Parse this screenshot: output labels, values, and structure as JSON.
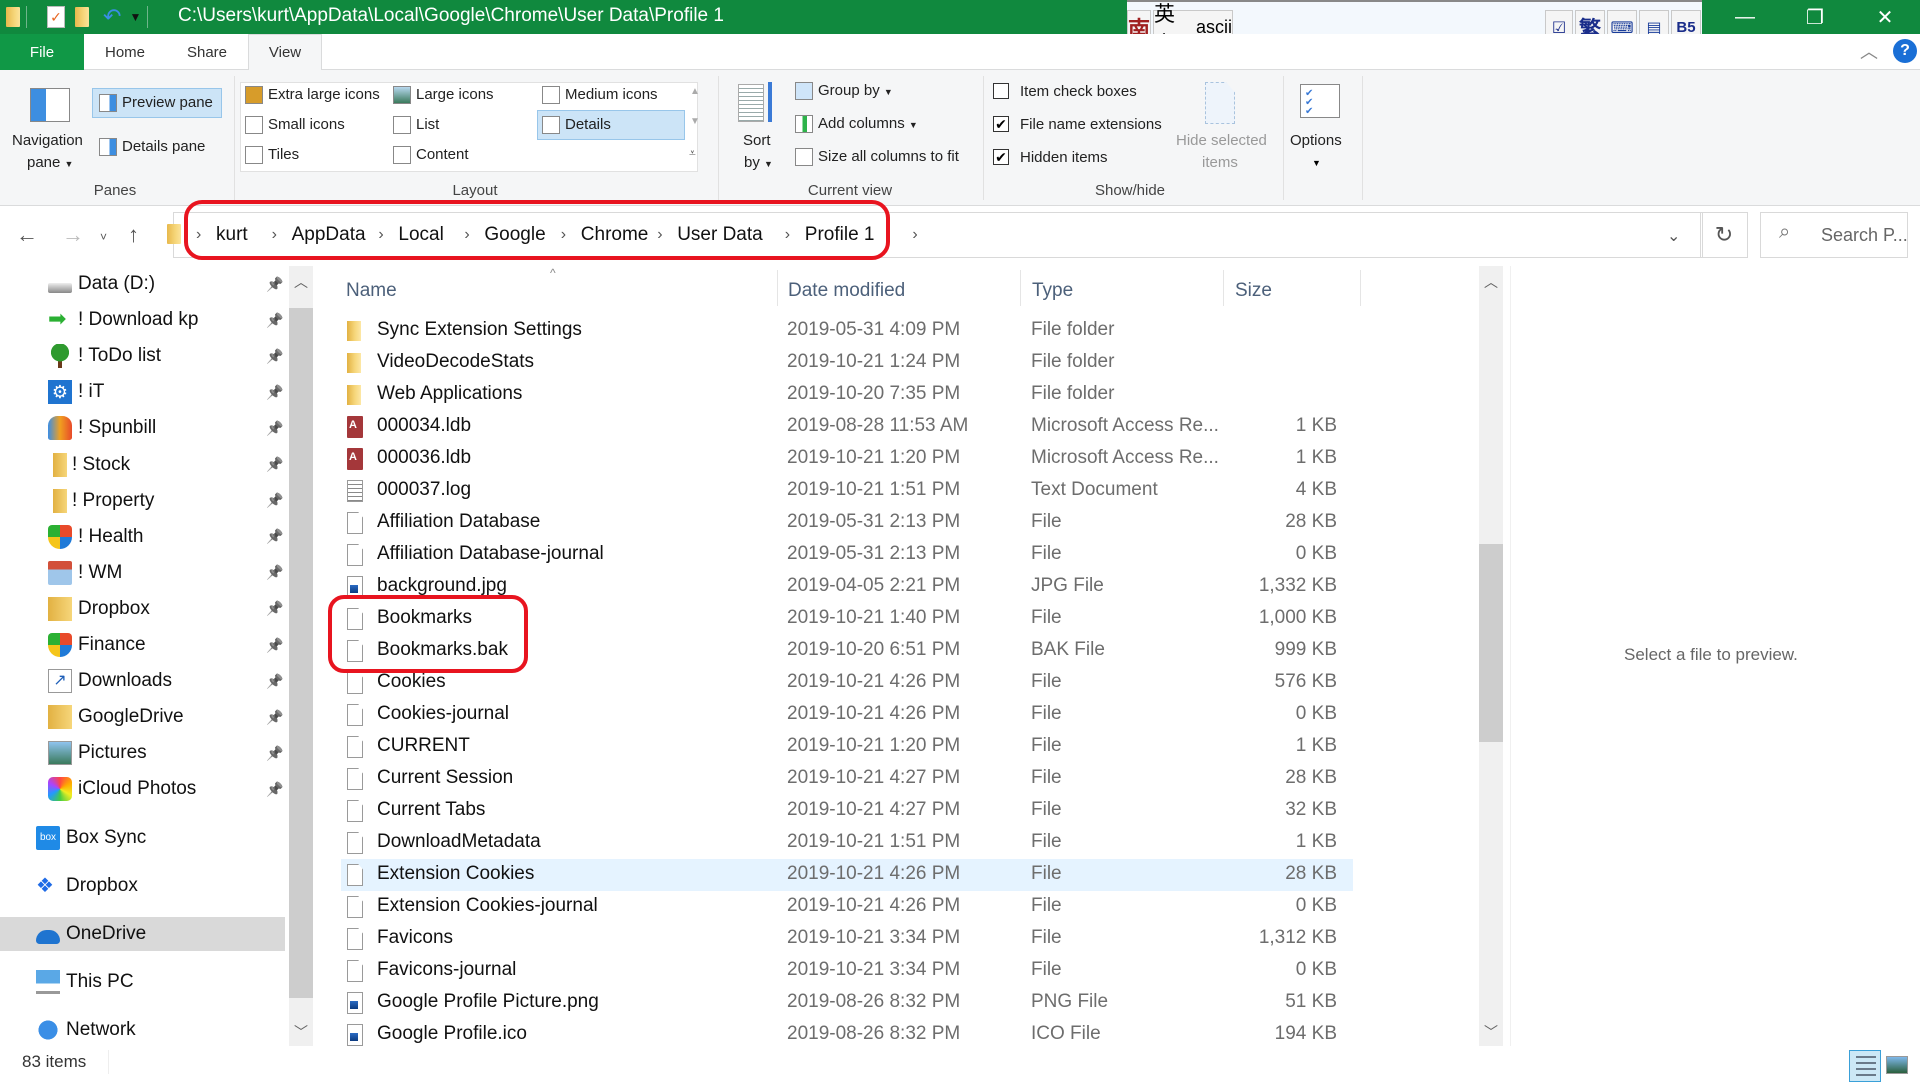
{
  "window": {
    "title_path": "C:\\Users\\kurt\\AppData\\Local\\Google\\Chrome\\User Data\\Profile 1",
    "minimize": "—",
    "maximize": "❐",
    "close": "✕"
  },
  "ime_bar": {
    "mode_char": "南",
    "lang": "英文",
    "ascii": "ascii",
    "trad_char": "繁",
    "b5": "B5"
  },
  "tabs": [
    {
      "label": "File"
    },
    {
      "label": "Home"
    },
    {
      "label": "Share"
    },
    {
      "label": "View",
      "active": true
    }
  ],
  "ribbon": {
    "panes": {
      "navigation_pane": "Navigation",
      "navigation_pane_2": "pane",
      "preview_pane": "Preview pane",
      "details_pane": "Details pane",
      "group_label": "Panes"
    },
    "layout": {
      "items": [
        "Extra large icons",
        "Large icons",
        "Medium icons",
        "Small icons",
        "List",
        "Details",
        "Tiles",
        "Content"
      ],
      "selected": "Details",
      "group_label": "Layout"
    },
    "current_view": {
      "sort_by": "Sort",
      "sort_by_2": "by",
      "group_by": "Group by",
      "add_columns": "Add columns",
      "size_all": "Size all columns to fit",
      "group_label": "Current view"
    },
    "show_hide": {
      "item_check_boxes": {
        "label": "Item check boxes",
        "checked": false
      },
      "file_name_extensions": {
        "label": "File name extensions",
        "checked": true
      },
      "hidden_items": {
        "label": "Hidden items",
        "checked": true
      },
      "hide_selected": "Hide selected",
      "hide_selected_2": "items",
      "group_label": "Show/hide"
    },
    "options": "Options"
  },
  "address": {
    "crumbs": [
      "kurt",
      "AppData",
      "Local",
      "Google",
      "Chrome",
      "User Data",
      "Profile 1"
    ],
    "search_placeholder": "Search P..."
  },
  "sidebar": {
    "quick_access": [
      {
        "label": "Data (D:)",
        "icon": "drive-icon"
      },
      {
        "label": "! Download kp",
        "icon": "green-arrow-icon"
      },
      {
        "label": "! ToDo list",
        "icon": "tree-icon"
      },
      {
        "label": "! iT",
        "icon": "gear-icon"
      },
      {
        "label": "! Spunbill",
        "icon": "butterfly-icon"
      },
      {
        "label": "! Stock",
        "icon": "folder-icon"
      },
      {
        "label": "! Property",
        "icon": "folder-icon"
      },
      {
        "label": "! Health",
        "icon": "shield-icon"
      },
      {
        "label": "! WM",
        "icon": "network-home-icon"
      },
      {
        "label": "Dropbox",
        "icon": "dropbox-folder-icon"
      },
      {
        "label": "Finance",
        "icon": "shield-icon"
      },
      {
        "label": "Downloads",
        "icon": "shortcut-icon"
      },
      {
        "label": "GoogleDrive",
        "icon": "google-drive-folder-icon"
      },
      {
        "label": "Pictures",
        "icon": "pictures-icon"
      },
      {
        "label": "iCloud Photos",
        "icon": "photos-icon"
      }
    ],
    "roots": [
      {
        "label": "Box Sync",
        "icon": "box-icon"
      },
      {
        "label": "Dropbox",
        "icon": "dropbox-icon"
      },
      {
        "label": "OneDrive",
        "icon": "onedrive-icon",
        "selected": true
      },
      {
        "label": "This PC",
        "icon": "computer-icon"
      },
      {
        "label": "Network",
        "icon": "network-icon"
      }
    ]
  },
  "file_list": {
    "columns": [
      "Name",
      "Date modified",
      "Type",
      "Size"
    ],
    "rows": [
      {
        "name": "Sync Extension Settings",
        "date": "2019-05-31 4:09 PM",
        "type": "File folder",
        "size": "",
        "icon": "folder"
      },
      {
        "name": "VideoDecodeStats",
        "date": "2019-10-21 1:24 PM",
        "type": "File folder",
        "size": "",
        "icon": "folder"
      },
      {
        "name": "Web Applications",
        "date": "2019-10-20 7:35 PM",
        "type": "File folder",
        "size": "",
        "icon": "folder"
      },
      {
        "name": "000034.ldb",
        "date": "2019-08-28 11:53 AM",
        "type": "Microsoft Access Re...",
        "size": "1 KB",
        "icon": "access"
      },
      {
        "name": "000036.ldb",
        "date": "2019-10-21 1:20 PM",
        "type": "Microsoft Access Re...",
        "size": "1 KB",
        "icon": "access"
      },
      {
        "name": "000037.log",
        "date": "2019-10-21 1:51 PM",
        "type": "Text Document",
        "size": "4 KB",
        "icon": "txt"
      },
      {
        "name": "Affiliation Database",
        "date": "2019-05-31 2:13 PM",
        "type": "File",
        "size": "28 KB",
        "icon": "file"
      },
      {
        "name": "Affiliation Database-journal",
        "date": "2019-05-31 2:13 PM",
        "type": "File",
        "size": "0 KB",
        "icon": "file"
      },
      {
        "name": "background.jpg",
        "date": "2019-04-05 2:21 PM",
        "type": "JPG File",
        "size": "1,332 KB",
        "icon": "img"
      },
      {
        "name": "Bookmarks",
        "date": "2019-10-21 1:40 PM",
        "type": "File",
        "size": "1,000 KB",
        "icon": "file"
      },
      {
        "name": "Bookmarks.bak",
        "date": "2019-10-20 6:51 PM",
        "type": "BAK File",
        "size": "999 KB",
        "icon": "file"
      },
      {
        "name": "Cookies",
        "date": "2019-10-21 4:26 PM",
        "type": "File",
        "size": "576 KB",
        "icon": "file"
      },
      {
        "name": "Cookies-journal",
        "date": "2019-10-21 4:26 PM",
        "type": "File",
        "size": "0 KB",
        "icon": "file"
      },
      {
        "name": "CURRENT",
        "date": "2019-10-21 1:20 PM",
        "type": "File",
        "size": "1 KB",
        "icon": "file"
      },
      {
        "name": "Current Session",
        "date": "2019-10-21 4:27 PM",
        "type": "File",
        "size": "28 KB",
        "icon": "file"
      },
      {
        "name": "Current Tabs",
        "date": "2019-10-21 4:27 PM",
        "type": "File",
        "size": "32 KB",
        "icon": "file"
      },
      {
        "name": "DownloadMetadata",
        "date": "2019-10-21 1:51 PM",
        "type": "File",
        "size": "1 KB",
        "icon": "file"
      },
      {
        "name": "Extension Cookies",
        "date": "2019-10-21 4:26 PM",
        "type": "File",
        "size": "28 KB",
        "icon": "file",
        "hover": true
      },
      {
        "name": "Extension Cookies-journal",
        "date": "2019-10-21 4:26 PM",
        "type": "File",
        "size": "0 KB",
        "icon": "file"
      },
      {
        "name": "Favicons",
        "date": "2019-10-21 3:34 PM",
        "type": "File",
        "size": "1,312 KB",
        "icon": "file"
      },
      {
        "name": "Favicons-journal",
        "date": "2019-10-21 3:34 PM",
        "type": "File",
        "size": "0 KB",
        "icon": "file"
      },
      {
        "name": "Google Profile Picture.png",
        "date": "2019-08-26 8:32 PM",
        "type": "PNG File",
        "size": "51 KB",
        "icon": "img"
      },
      {
        "name": "Google Profile.ico",
        "date": "2019-08-26 8:32 PM",
        "type": "ICO File",
        "size": "194 KB",
        "icon": "img"
      }
    ]
  },
  "preview": {
    "message": "Select a file to preview."
  },
  "status": {
    "item_count": "83 items"
  },
  "colors": {
    "title_bar": "#10893e",
    "file_tab": "#109846",
    "selection": "#cce4f7",
    "hover_row": "#e5f3ff",
    "annotation": "#e8141f"
  }
}
